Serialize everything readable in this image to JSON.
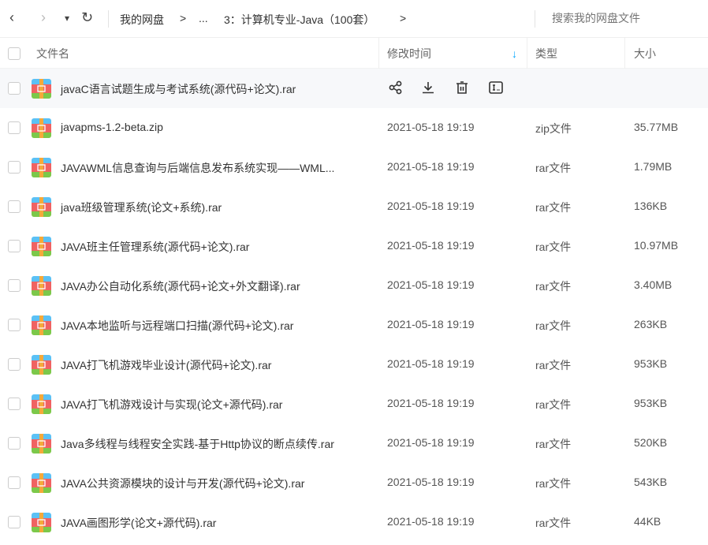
{
  "toolbar": {
    "back": "‹",
    "forward": "›",
    "dropdown": "▾",
    "refresh": "↻",
    "breadcrumb": [
      "我的网盘",
      ">",
      "...",
      "3：计算机专业-Java（100套）",
      ">"
    ],
    "search_placeholder": "搜索我的网盘文件"
  },
  "columns": {
    "name": "文件名",
    "modified": "修改时间",
    "sort_arrow": "↓",
    "type": "类型",
    "size": "大小"
  },
  "files": [
    {
      "name": "javaC语言试题生成与考试系统(源代码+论文).rar",
      "modified": "",
      "type": "",
      "size": ""
    },
    {
      "name": "javapms-1.2-beta.zip",
      "modified": "2021-05-18 19:19",
      "type": "zip文件",
      "size": "35.77MB"
    },
    {
      "name": "JAVAWML信息查询与后端信息发布系统实现——WML...",
      "modified": "2021-05-18 19:19",
      "type": "rar文件",
      "size": "1.79MB"
    },
    {
      "name": "java班级管理系统(论文+系统).rar",
      "modified": "2021-05-18 19:19",
      "type": "rar文件",
      "size": "136KB"
    },
    {
      "name": "JAVA班主任管理系统(源代码+论文).rar",
      "modified": "2021-05-18 19:19",
      "type": "rar文件",
      "size": "10.97MB"
    },
    {
      "name": "JAVA办公自动化系统(源代码+论文+外文翻译).rar",
      "modified": "2021-05-18 19:19",
      "type": "rar文件",
      "size": "3.40MB"
    },
    {
      "name": "JAVA本地监听与远程端口扫描(源代码+论文).rar",
      "modified": "2021-05-18 19:19",
      "type": "rar文件",
      "size": "263KB"
    },
    {
      "name": "JAVA打飞机游戏毕业设计(源代码+论文).rar",
      "modified": "2021-05-18 19:19",
      "type": "rar文件",
      "size": "953KB"
    },
    {
      "name": "JAVA打飞机游戏设计与实现(论文+源代码).rar",
      "modified": "2021-05-18 19:19",
      "type": "rar文件",
      "size": "953KB"
    },
    {
      "name": "Java多线程与线程安全实践-基于Http协议的断点续传.rar",
      "modified": "2021-05-18 19:19",
      "type": "rar文件",
      "size": "520KB"
    },
    {
      "name": "JAVA公共资源模块的设计与开发(源代码+论文).rar",
      "modified": "2021-05-18 19:19",
      "type": "rar文件",
      "size": "543KB"
    },
    {
      "name": "JAVA画图形学(论文+源代码).rar",
      "modified": "2021-05-18 19:19",
      "type": "rar文件",
      "size": "44KB"
    }
  ],
  "colors": {
    "accent": "#06a7ff"
  }
}
